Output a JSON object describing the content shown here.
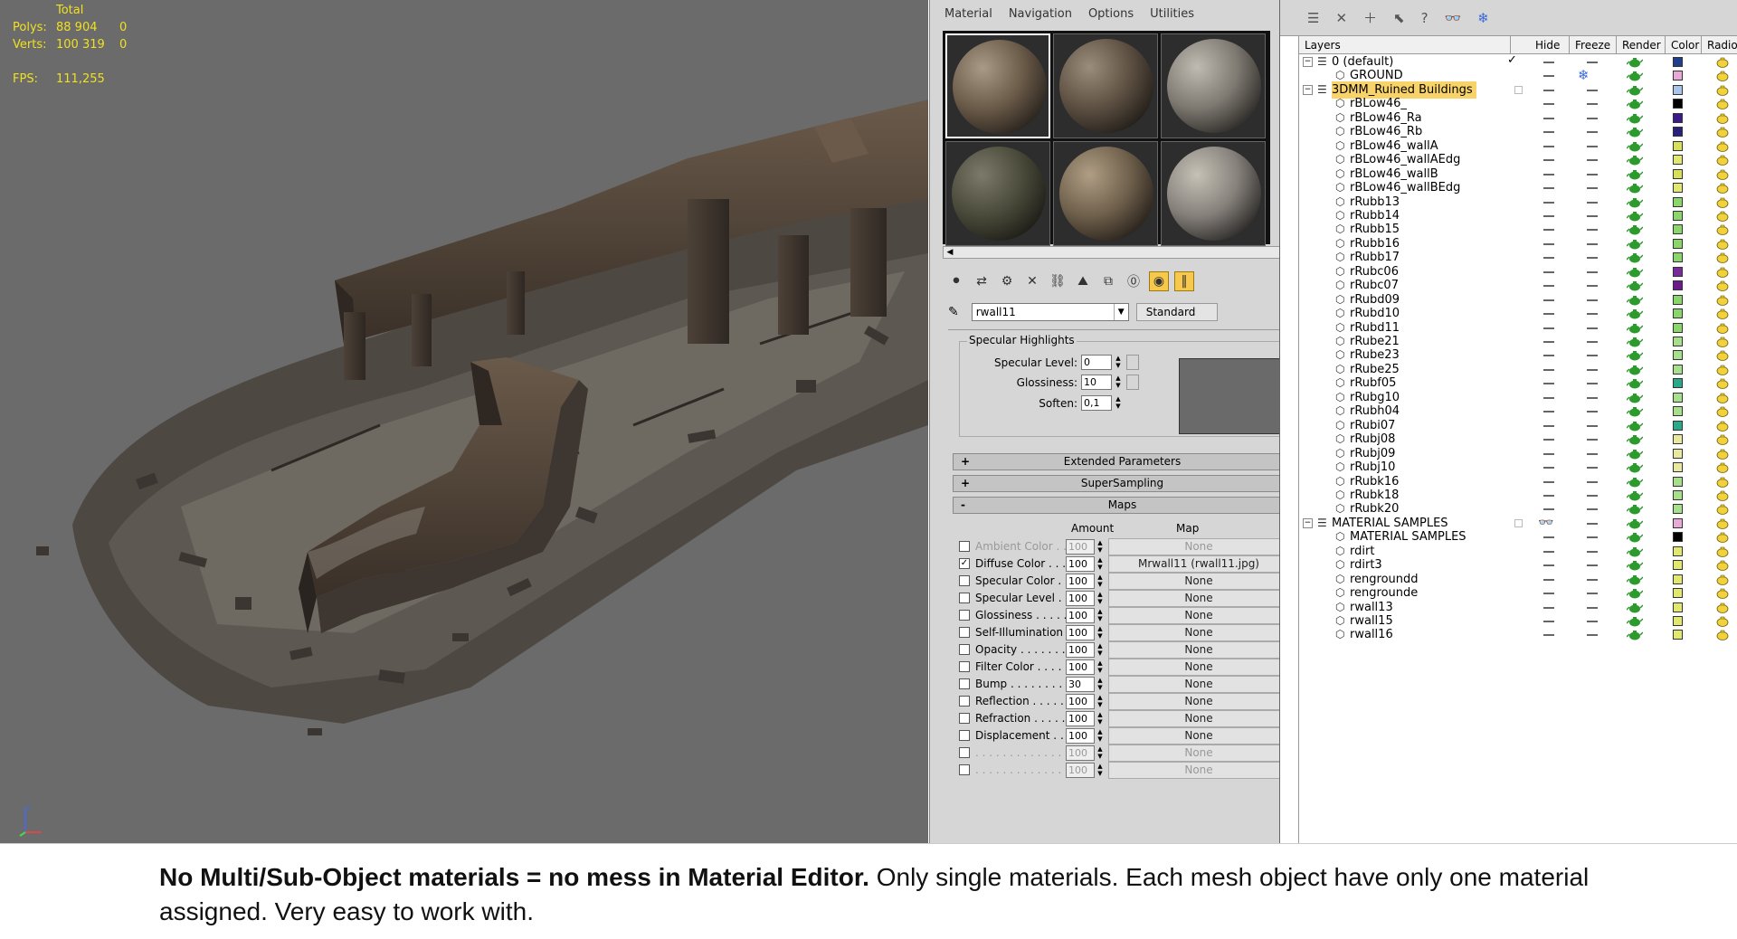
{
  "viewport": {
    "stats": [
      {
        "key": "",
        "value": "Total",
        "value2": ""
      },
      {
        "key": "Polys:",
        "value": "88 904",
        "value2": "0"
      },
      {
        "key": "Verts:",
        "value": "100 319",
        "value2": "0"
      },
      {
        "key": "",
        "value": "",
        "value2": ""
      },
      {
        "key": "FPS:",
        "value": "111,255",
        "value2": ""
      }
    ],
    "colors": {
      "background": "#6b6b6b",
      "stats": "#f0e020"
    }
  },
  "material_editor": {
    "menu": [
      "Material",
      "Navigation",
      "Options",
      "Utilities"
    ],
    "material_name": "rwall11",
    "material_type": "Standard",
    "specular": {
      "title": "Specular Highlights",
      "rows": [
        {
          "label": "Specular Level:",
          "value": "0"
        },
        {
          "label": "Glossiness:",
          "value": "10"
        },
        {
          "label": "Soften:",
          "value": "0,1"
        }
      ]
    },
    "rollouts": [
      {
        "sign": "+",
        "label": "Extended Parameters"
      },
      {
        "sign": "+",
        "label": "SuperSampling"
      },
      {
        "sign": "-",
        "label": "Maps"
      }
    ],
    "maps_header": {
      "amount": "Amount",
      "map": "Map"
    },
    "maps": [
      {
        "label": "Ambient Color . . .",
        "amount": "100",
        "map": "None",
        "checked": false,
        "disabled": true
      },
      {
        "label": "Diffuse Color . . .",
        "amount": "100",
        "map": "Mrwall11 (rwall11.jpg)",
        "checked": true,
        "disabled": false
      },
      {
        "label": "Specular Color . .",
        "amount": "100",
        "map": "None",
        "checked": false,
        "disabled": false
      },
      {
        "label": "Specular Level . .",
        "amount": "100",
        "map": "None",
        "checked": false,
        "disabled": false
      },
      {
        "label": "Glossiness . . . . .",
        "amount": "100",
        "map": "None",
        "checked": false,
        "disabled": false
      },
      {
        "label": "Self-Illumination .",
        "amount": "100",
        "map": "None",
        "checked": false,
        "disabled": false
      },
      {
        "label": "Opacity . . . . . . .",
        "amount": "100",
        "map": "None",
        "checked": false,
        "disabled": false
      },
      {
        "label": "Filter Color . . . .",
        "amount": "100",
        "map": "None",
        "checked": false,
        "disabled": false
      },
      {
        "label": "Bump . . . . . . . . .",
        "amount": "30",
        "map": "None",
        "checked": false,
        "disabled": false
      },
      {
        "label": "Reflection . . . . .",
        "amount": "100",
        "map": "None",
        "checked": false,
        "disabled": false
      },
      {
        "label": "Refraction . . . . .",
        "amount": "100",
        "map": "None",
        "checked": false,
        "disabled": false
      },
      {
        "label": "Displacement . .",
        "amount": "100",
        "map": "None",
        "checked": false,
        "disabled": false
      },
      {
        "label": ". . . . . . . . . . . . .",
        "amount": "100",
        "map": "None",
        "checked": false,
        "disabled": true
      },
      {
        "label": ". . . . . . . . . . . . .",
        "amount": "100",
        "map": "None",
        "checked": false,
        "disabled": true
      }
    ]
  },
  "layer_manager": {
    "columns": [
      "Layers",
      "Hide",
      "Freeze",
      "Render",
      "Color",
      "Radios"
    ],
    "rows": [
      {
        "name": "0 (default)",
        "type": "layer",
        "current": true,
        "color": "#1f3f8a"
      },
      {
        "name": "GROUND",
        "type": "object",
        "frozen": true,
        "color": "#e7a9d8"
      },
      {
        "name": "3DMM_Ruined Buildings",
        "type": "layer",
        "selected": true,
        "color": "#a9c6ea"
      },
      {
        "name": "rBLow46_",
        "type": "object",
        "color": "#000000"
      },
      {
        "name": "rBLow46_Ra",
        "type": "object",
        "color": "#3c1a8a"
      },
      {
        "name": "rBLow46_Rb",
        "type": "object",
        "color": "#2a1f7a"
      },
      {
        "name": "rBLow46_wallA",
        "type": "object",
        "color": "#d8e05a"
      },
      {
        "name": "rBLow46_wallAEdg",
        "type": "object",
        "color": "#e0e870"
      },
      {
        "name": "rBLow46_wallB",
        "type": "object",
        "color": "#d8e05a"
      },
      {
        "name": "rBLow46_wallBEdg",
        "type": "object",
        "color": "#e0e870"
      },
      {
        "name": "rRubb13",
        "type": "object",
        "color": "#8ad66a"
      },
      {
        "name": "rRubb14",
        "type": "object",
        "color": "#8ad66a"
      },
      {
        "name": "rRubb15",
        "type": "object",
        "color": "#8ad66a"
      },
      {
        "name": "rRubb16",
        "type": "object",
        "color": "#8ad66a"
      },
      {
        "name": "rRubb17",
        "type": "object",
        "color": "#8ad66a"
      },
      {
        "name": "rRubc06",
        "type": "object",
        "color": "#7a2a9a"
      },
      {
        "name": "rRubc07",
        "type": "object",
        "color": "#6a1a8a"
      },
      {
        "name": "rRubd09",
        "type": "object",
        "color": "#8ad66a"
      },
      {
        "name": "rRubd10",
        "type": "object",
        "color": "#8ad66a"
      },
      {
        "name": "rRubd11",
        "type": "object",
        "color": "#8ad66a"
      },
      {
        "name": "rRube21",
        "type": "object",
        "color": "#a6e08a"
      },
      {
        "name": "rRube23",
        "type": "object",
        "color": "#a6e08a"
      },
      {
        "name": "rRube25",
        "type": "object",
        "color": "#a6e08a"
      },
      {
        "name": "rRubf05",
        "type": "object",
        "color": "#2aa88a"
      },
      {
        "name": "rRubg10",
        "type": "object",
        "color": "#a6e08a"
      },
      {
        "name": "rRubh04",
        "type": "object",
        "color": "#a6e08a"
      },
      {
        "name": "rRubi07",
        "type": "object",
        "color": "#2aa88a"
      },
      {
        "name": "rRubj08",
        "type": "object",
        "color": "#e8e8a0"
      },
      {
        "name": "rRubj09",
        "type": "object",
        "color": "#e8e8a0"
      },
      {
        "name": "rRubj10",
        "type": "object",
        "color": "#e8e8a0"
      },
      {
        "name": "rRubk16",
        "type": "object",
        "color": "#a6e08a"
      },
      {
        "name": "rRubk18",
        "type": "object",
        "color": "#a6e08a"
      },
      {
        "name": "rRubk20",
        "type": "object",
        "color": "#a6e08a"
      },
      {
        "name": "MATERIAL SAMPLES",
        "type": "layer",
        "hidden": true,
        "color": "#e7a9d8"
      },
      {
        "name": "MATERIAL SAMPLES",
        "type": "object",
        "color": "#000000"
      },
      {
        "name": "rdirt",
        "type": "object",
        "color": "#e0e870"
      },
      {
        "name": "rdirt3",
        "type": "object",
        "color": "#e0e870"
      },
      {
        "name": "rengroundd",
        "type": "object",
        "color": "#e0e870"
      },
      {
        "name": "rengrounde",
        "type": "object",
        "color": "#e0e870"
      },
      {
        "name": "rwall13",
        "type": "object",
        "color": "#e0e870"
      },
      {
        "name": "rwall15",
        "type": "object",
        "color": "#e0e870"
      },
      {
        "name": "rwall16",
        "type": "object",
        "color": "#e0e870"
      }
    ]
  },
  "caption": {
    "bold": "No Multi/Sub-Object materials = no mess in Material Editor.",
    "rest": " Only single materials. Each mesh object have only one material assigned. Very easy to work with."
  }
}
